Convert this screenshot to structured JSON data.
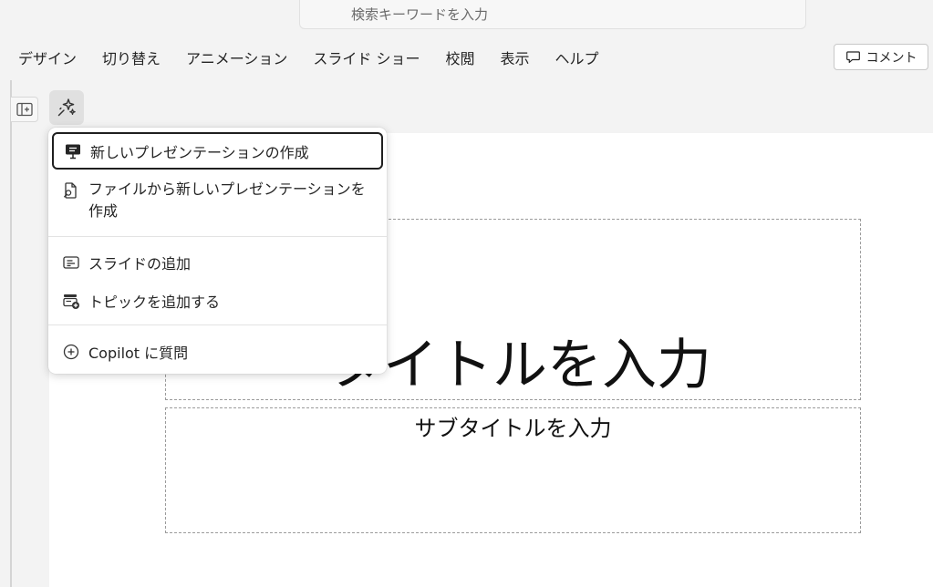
{
  "search": {
    "placeholder": "検索キーワードを入力"
  },
  "ribbon": {
    "tabs": [
      "デザイン",
      "切り替え",
      "アニメーション",
      "スライド ショー",
      "校閲",
      "表示",
      "ヘルプ"
    ],
    "comment_label": "コメント"
  },
  "slide": {
    "title_placeholder": "タイトルを入力",
    "subtitle_placeholder": "サブタイトルを入力"
  },
  "copilot_menu": {
    "items": [
      {
        "label": "新しいプレゼンテーションの作成",
        "icon": "presentation-icon"
      },
      {
        "label": "ファイルから新しいプレゼンテーションを作成",
        "icon": "file-search-icon"
      },
      {
        "label": "スライドの追加",
        "icon": "slide-text-icon"
      },
      {
        "label": "トピックを追加する",
        "icon": "topic-add-icon"
      },
      {
        "label": "Copilot に質問",
        "icon": "add-circle-icon"
      }
    ]
  }
}
